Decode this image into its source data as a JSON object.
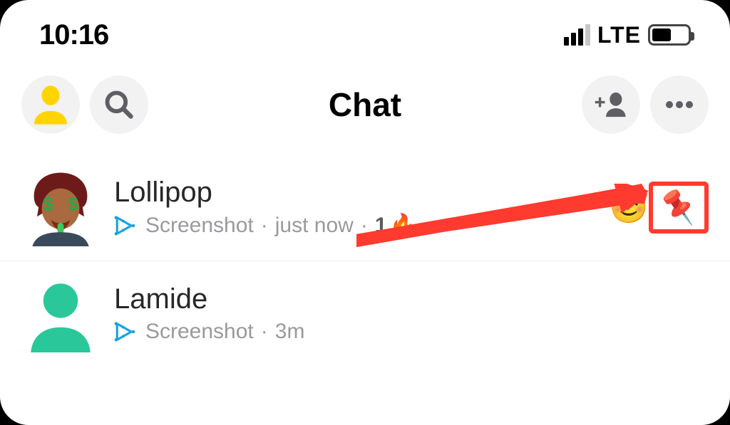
{
  "status": {
    "time": "10:16",
    "network_label": "LTE"
  },
  "header": {
    "title": "Chat"
  },
  "chats": [
    {
      "name": "Lollipop",
      "status_text": "Screenshot",
      "time": "just now",
      "streak_count": "1",
      "pinned": true
    },
    {
      "name": "Lamide",
      "status_text": "Screenshot",
      "time": "3m"
    }
  ]
}
